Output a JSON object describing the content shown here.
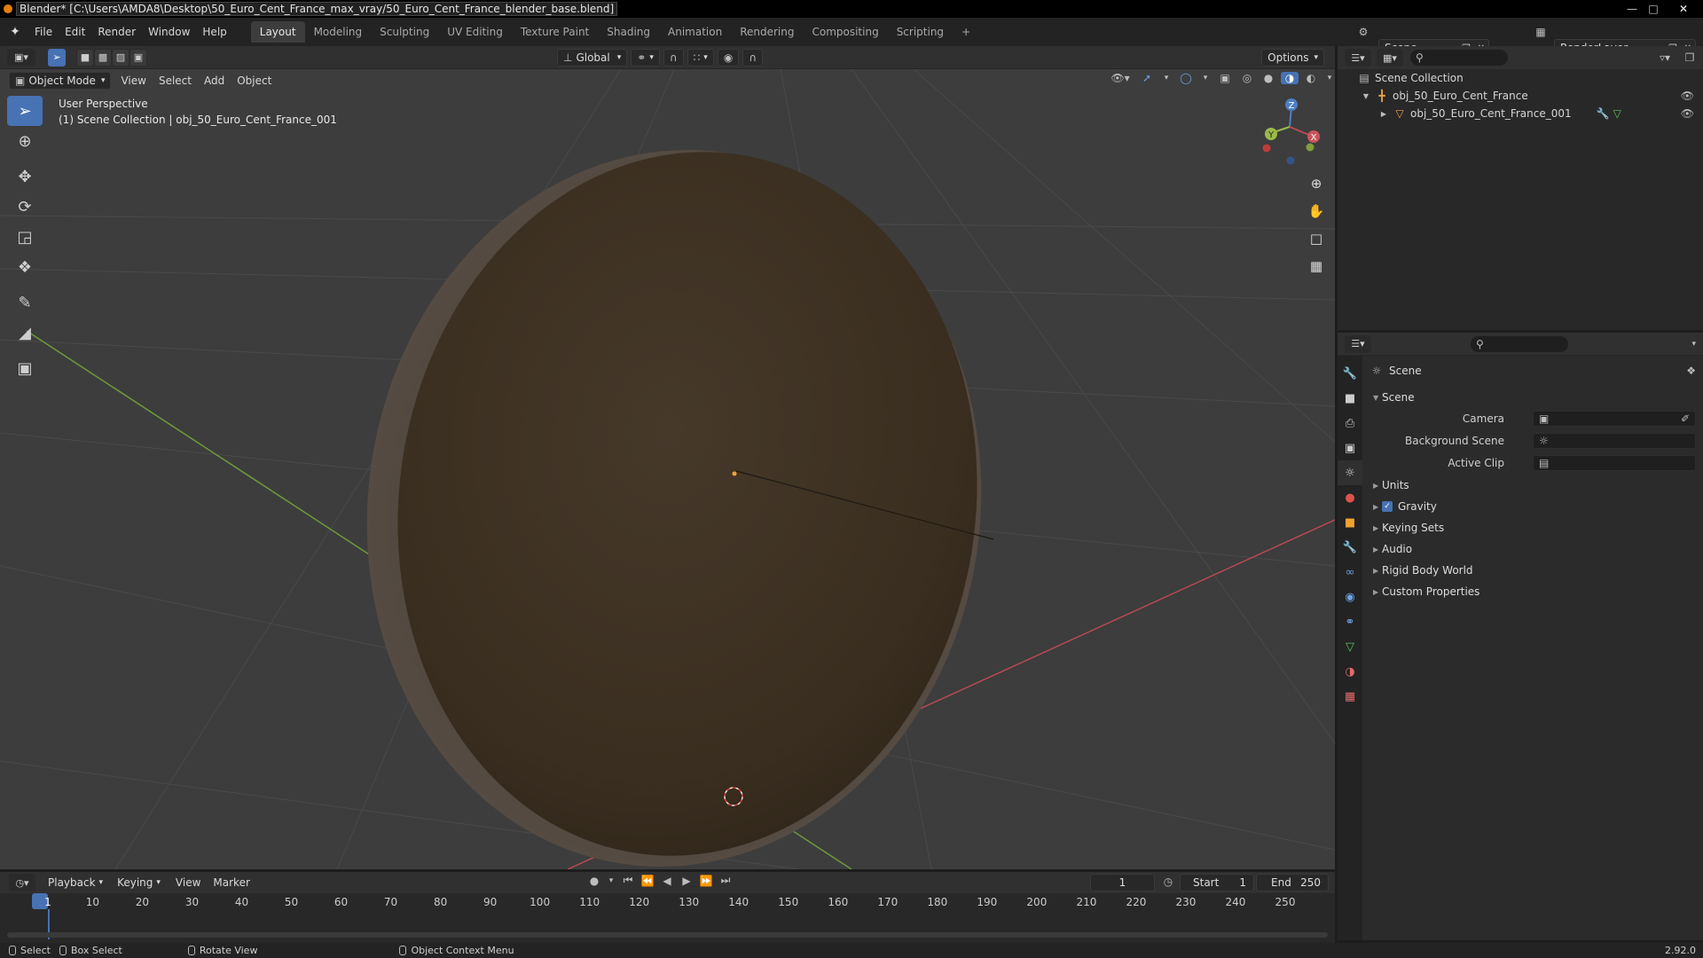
{
  "titlebar": {
    "title": "Blender* [C:\\Users\\AMDA8\\Desktop\\50_Euro_Cent_France_max_vray/50_Euro_Cent_France_blender_base.blend]",
    "buttons": [
      "minimize",
      "maximize",
      "close"
    ]
  },
  "menubar": {
    "menus": [
      "File",
      "Edit",
      "Render",
      "Window",
      "Help"
    ],
    "workspaces": [
      "Layout",
      "Modeling",
      "Sculpting",
      "UV Editing",
      "Texture Paint",
      "Shading",
      "Animation",
      "Rendering",
      "Compositing",
      "Scripting"
    ],
    "active_workspace": "Layout",
    "add_tab": "+",
    "scene": "Scene",
    "view_layer": "RenderLayer"
  },
  "tool_header": {
    "orientation": "Global",
    "options": "Options"
  },
  "viewport_header": {
    "mode": "Object Mode",
    "menus": [
      "View",
      "Select",
      "Add",
      "Object"
    ]
  },
  "viewport": {
    "perspective_label": "User Perspective",
    "collection_label": "(1) Scene Collection | obj_50_Euro_Cent_France_001",
    "gizmo_axes": [
      "X",
      "Y",
      "Z"
    ],
    "colors": {
      "background": "#3d3d3d",
      "x_axis": "#b84a52",
      "y_axis": "#6e9a3a",
      "coin": "#3c3020"
    }
  },
  "toolbar": {
    "tools": [
      "select-box",
      "cursor",
      "move",
      "rotate",
      "scale",
      "transform",
      "annotate",
      "measure",
      "add-cube"
    ]
  },
  "outliner": {
    "root": "Scene Collection",
    "items": [
      {
        "label": "obj_50_Euro_Cent_France",
        "depth": 1
      },
      {
        "label": "obj_50_Euro_Cent_France_001",
        "depth": 2
      }
    ]
  },
  "properties": {
    "context": "Scene",
    "panel_title": "Scene",
    "fields": [
      {
        "label": "Camera",
        "value": ""
      },
      {
        "label": "Background Scene",
        "value": ""
      },
      {
        "label": "Active Clip",
        "value": ""
      }
    ],
    "sections": [
      "Units",
      "Gravity",
      "Keying Sets",
      "Audio",
      "Rigid Body World",
      "Custom Properties"
    ],
    "gravity_checked": true
  },
  "timeline": {
    "menus": [
      "Playback",
      "Keying",
      "View",
      "Marker"
    ],
    "current_frame": "1",
    "start_label": "Start",
    "start": "1",
    "end_label": "End",
    "end": "250",
    "ticks": [
      "1",
      "10",
      "20",
      "30",
      "40",
      "50",
      "60",
      "70",
      "80",
      "90",
      "100",
      "110",
      "120",
      "130",
      "140",
      "150",
      "160",
      "170",
      "180",
      "190",
      "200",
      "210",
      "220",
      "230",
      "240",
      "250"
    ]
  },
  "statusbar": {
    "items": [
      "Select",
      "Box Select",
      "Rotate View",
      "Object Context Menu"
    ],
    "version": "2.92.0"
  }
}
